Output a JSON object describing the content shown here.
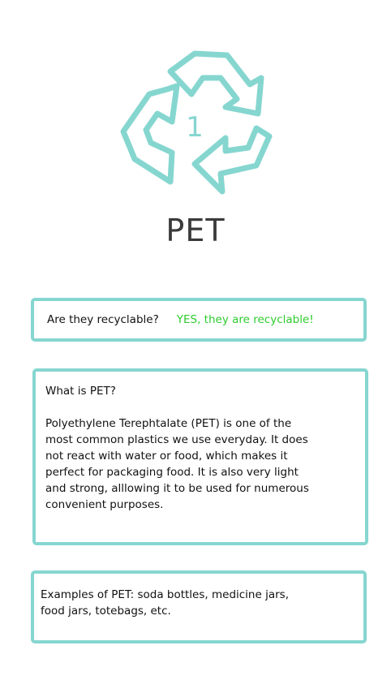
{
  "logo": {
    "icon": "recycle-icon",
    "number": "1",
    "color": "#86d6d0"
  },
  "title": "PET",
  "recyclable": {
    "question": "Are they recyclable?",
    "answer": "YES, they are recyclable!",
    "answer_color": "#2ecc2e"
  },
  "info": {
    "heading": "What is PET?",
    "body": "Polyethylene Terephtalate (PET) is one of the\nmost common plastics we use everyday. It does\nnot react with water or food, which makes it\nperfect for packaging  food. It is also very light\nand strong, alllowing it to be used for numerous\nconvenient purposes."
  },
  "examples": {
    "text": "Examples of PET: soda bottles, medicine jars,\nfood jars, totebags, etc."
  },
  "accent_color": "#86d6d0"
}
